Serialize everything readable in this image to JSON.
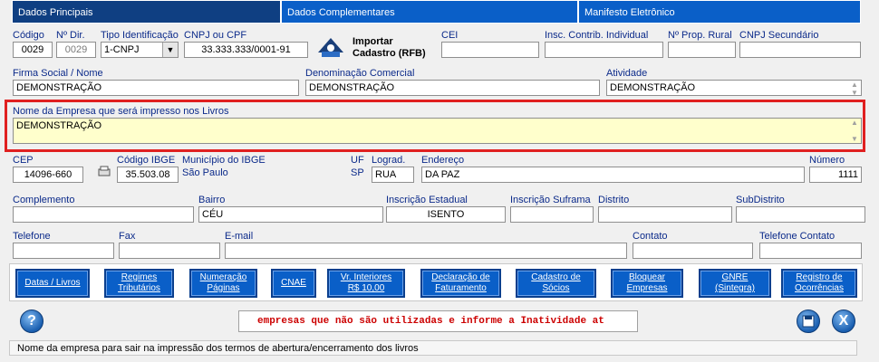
{
  "tabs": [
    "Dados Principais",
    "Dados Complementares",
    "Manifesto Eletrônico"
  ],
  "row1": {
    "codigo": {
      "label": "Código",
      "value": "0029"
    },
    "ndir": {
      "label": "Nº Dir.",
      "value": "0029"
    },
    "tipo": {
      "label": "Tipo Identificação",
      "value": "1-CNPJ"
    },
    "cnpj": {
      "label": "CNPJ ou CPF",
      "value": "33.333.333/0001-91"
    },
    "importar": {
      "line1": "Importar",
      "line2": "Cadastro (RFB)"
    },
    "cei": {
      "label": "CEI",
      "value": ""
    },
    "insc_individual": {
      "label": "Insc. Contrib. Individual",
      "value": ""
    },
    "prop_rural": {
      "label": "Nº Prop. Rural",
      "value": ""
    },
    "cnpj_sec": {
      "label": "CNPJ Secundário",
      "value": ""
    }
  },
  "row2": {
    "firma": {
      "label": "Firma Social / Nome",
      "value": "DEMONSTRAÇÃO"
    },
    "denominacao": {
      "label": "Denominação Comercial",
      "value": "DEMONSTRAÇÃO"
    },
    "atividade": {
      "label": "Atividade",
      "value": "DEMONSTRAÇÃO"
    }
  },
  "nome_livros": {
    "label": "Nome da Empresa que será impresso nos Livros",
    "value": "DEMONSTRAÇÃO"
  },
  "row4": {
    "cep": {
      "label": "CEP",
      "value": "14096-660"
    },
    "ibge": {
      "label": "Código IBGE",
      "value": "35.503.08"
    },
    "municipio": {
      "label": "Município do IBGE",
      "value": "São Paulo"
    },
    "uf": {
      "label": "UF",
      "value": "SP"
    },
    "lograd": {
      "label": "Lograd.",
      "value": "RUA"
    },
    "endereco": {
      "label": "Endereço",
      "value": "DA PAZ"
    },
    "numero": {
      "label": "Número",
      "value": "1111"
    }
  },
  "row5": {
    "complemento": {
      "label": "Complemento",
      "value": ""
    },
    "bairro": {
      "label": "Bairro",
      "value": "CÉU"
    },
    "insc_estadual": {
      "label": "Inscrição Estadual",
      "value": "ISENTO"
    },
    "suframa": {
      "label": "Inscrição Suframa",
      "value": ""
    },
    "distrito": {
      "label": "Distrito",
      "value": ""
    },
    "subdistrito": {
      "label": "SubDistrito",
      "value": ""
    }
  },
  "row6": {
    "telefone": {
      "label": "Telefone",
      "value": ""
    },
    "fax": {
      "label": "Fax",
      "value": ""
    },
    "email": {
      "label": "E-mail",
      "value": ""
    },
    "contato": {
      "label": "Contato",
      "value": ""
    },
    "tel_contato": {
      "label": "Telefone Contato",
      "value": ""
    }
  },
  "buttons": [
    {
      "l1": "Datas / Livros",
      "l2": ""
    },
    {
      "l1": "Regimes",
      "l2": "Tributários"
    },
    {
      "l1": "Numeração",
      "l2": "Páginas"
    },
    {
      "l1": "CNAE",
      "l2": ""
    },
    {
      "l1": "Vr. Interiores",
      "l2": "R$ 10,00"
    },
    {
      "l1": "Declaração de",
      "l2": "Faturamento"
    },
    {
      "l1": "Cadastro de",
      "l2": "Sócios"
    },
    {
      "l1": "Bloquear",
      "l2": "Empresas"
    },
    {
      "l1": "GNRE",
      "l2": "(Sintegra)"
    },
    {
      "l1": "Registro de",
      "l2": "Ocorrências"
    }
  ],
  "marquee": "empresas que não são utilizadas e informe a Inatividade at",
  "help_glyph": "?",
  "close_glyph": "X",
  "status": "Nome da empresa para sair na impressão dos termos de abertura/encerramento dos livros",
  "colors": {
    "accent": "#0a5fc8",
    "highlight_border": "#e02020",
    "marquee_text": "#cc0000",
    "highlight_bg": "#ffffcc"
  }
}
